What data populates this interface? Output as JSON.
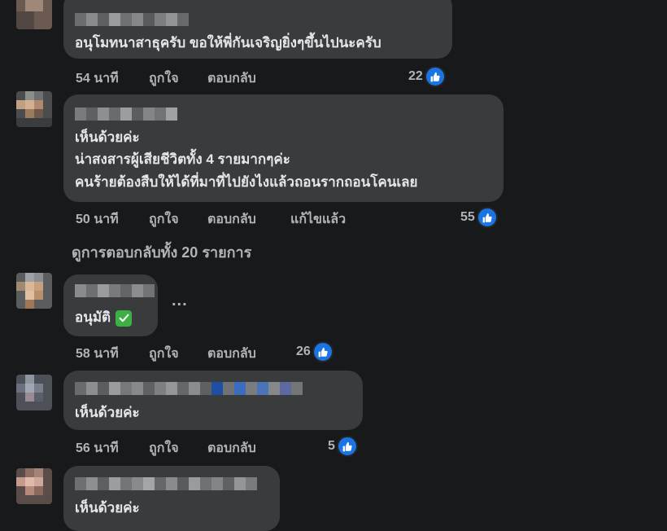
{
  "comments": [
    {
      "text_lines": [
        "อนุโมทนาสาธุครับ ขอให้พี่กันเจริญยิ่งๆขึ้นไปนะครับ"
      ],
      "time": "54 นาที",
      "like": "ถูกใจ",
      "reply": "ตอบกลับ",
      "edited": "",
      "reactions": "22"
    },
    {
      "text_lines": [
        "เห็นด้วยค่ะ",
        "น่าสงสารผู้เสียชีวิตทั้ง 4 รายมากๆค่ะ",
        "คนร้ายต้องสืบให้ได้ที่มาที่ไปยังไงแล้วถอนรากถอนโคนเลย"
      ],
      "time": "50 นาที",
      "like": "ถูกใจ",
      "reply": "ตอบกลับ",
      "edited": "แก้ไขแล้ว",
      "reactions": "55"
    },
    {
      "text_lines": [
        "อนุมัติ"
      ],
      "time": "58 นาที",
      "like": "ถูกใจ",
      "reply": "ตอบกลับ",
      "edited": "",
      "reactions": "26"
    },
    {
      "text_lines": [
        "เห็นด้วยค่ะ"
      ],
      "time": "56 นาที",
      "like": "ถูกใจ",
      "reply": "ตอบกลับ",
      "edited": "",
      "reactions": "5"
    },
    {
      "text_lines": [
        "เห็นด้วยค่ะ"
      ]
    }
  ],
  "view_replies": "ดูการตอบกลับทั้ง 20 รายการ",
  "more_options": "...",
  "icons": {
    "reaction": "like-icon",
    "approve": "check-mark-icon",
    "options": "more-options-icon"
  },
  "colors": {
    "background": "#18191a",
    "bubble": "#3a3b3c",
    "like_blue": "#1b74e4",
    "check_green": "#3cb043"
  }
}
